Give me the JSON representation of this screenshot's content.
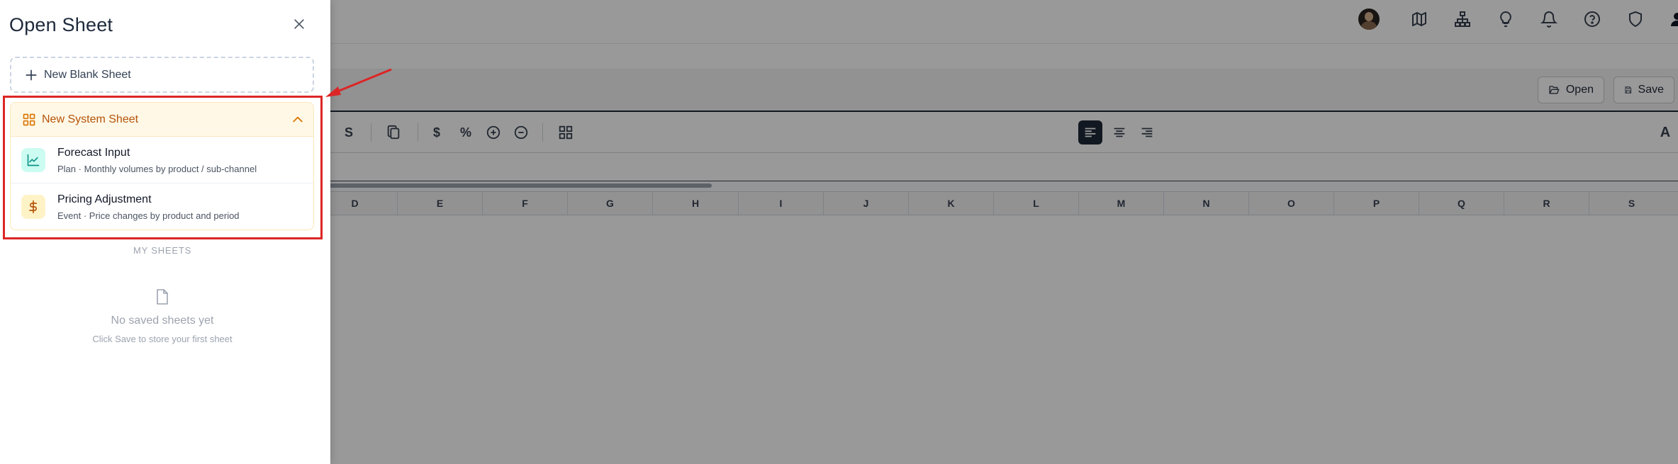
{
  "drawer": {
    "title": "Open Sheet",
    "new_blank_label": "New Blank Sheet",
    "system_section": {
      "label": "New System Sheet",
      "items": [
        {
          "name": "Forecast Input",
          "description": "Plan · Monthly volumes by product / sub-channel",
          "icon": "chart-line-icon"
        },
        {
          "name": "Pricing Adjustment",
          "description": "Event · Price changes by product and period",
          "icon": "dollar-icon"
        }
      ]
    },
    "my_sheets_label": "MY SHEETS",
    "empty_title": "No saved sheets yet",
    "empty_subtitle": "Click Save to store your first sheet"
  },
  "actions": {
    "open_label": "Open",
    "save_label": "Save"
  },
  "toolbar": {
    "partial_label": "S",
    "dollar": "$",
    "percent": "%",
    "font_label": "A"
  },
  "columns": [
    "D",
    "E",
    "F",
    "G",
    "H",
    "I",
    "J",
    "K",
    "L",
    "M",
    "N",
    "O",
    "P",
    "Q",
    "R",
    "S"
  ],
  "colors": {
    "accent": "#b45309",
    "highlight": "#dc2626",
    "teal": "#0d9488"
  }
}
